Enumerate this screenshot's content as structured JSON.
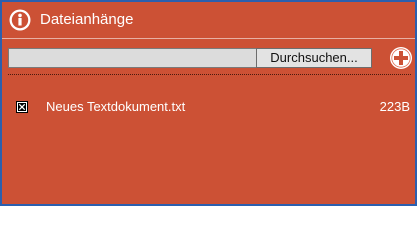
{
  "header": {
    "title": "Dateianhänge",
    "icon": "info-icon"
  },
  "upload": {
    "browse_label": "Durchsuchen...",
    "file_value": "",
    "add_icon": "plus-circle-icon"
  },
  "attachments": [
    {
      "name": "Neues Textdokument.txt",
      "size": "223B",
      "icon": "delete-checkbox-icon"
    }
  ],
  "colors": {
    "panel_bg": "#cc5135",
    "border": "#2b5fae",
    "text": "#ffffff"
  }
}
